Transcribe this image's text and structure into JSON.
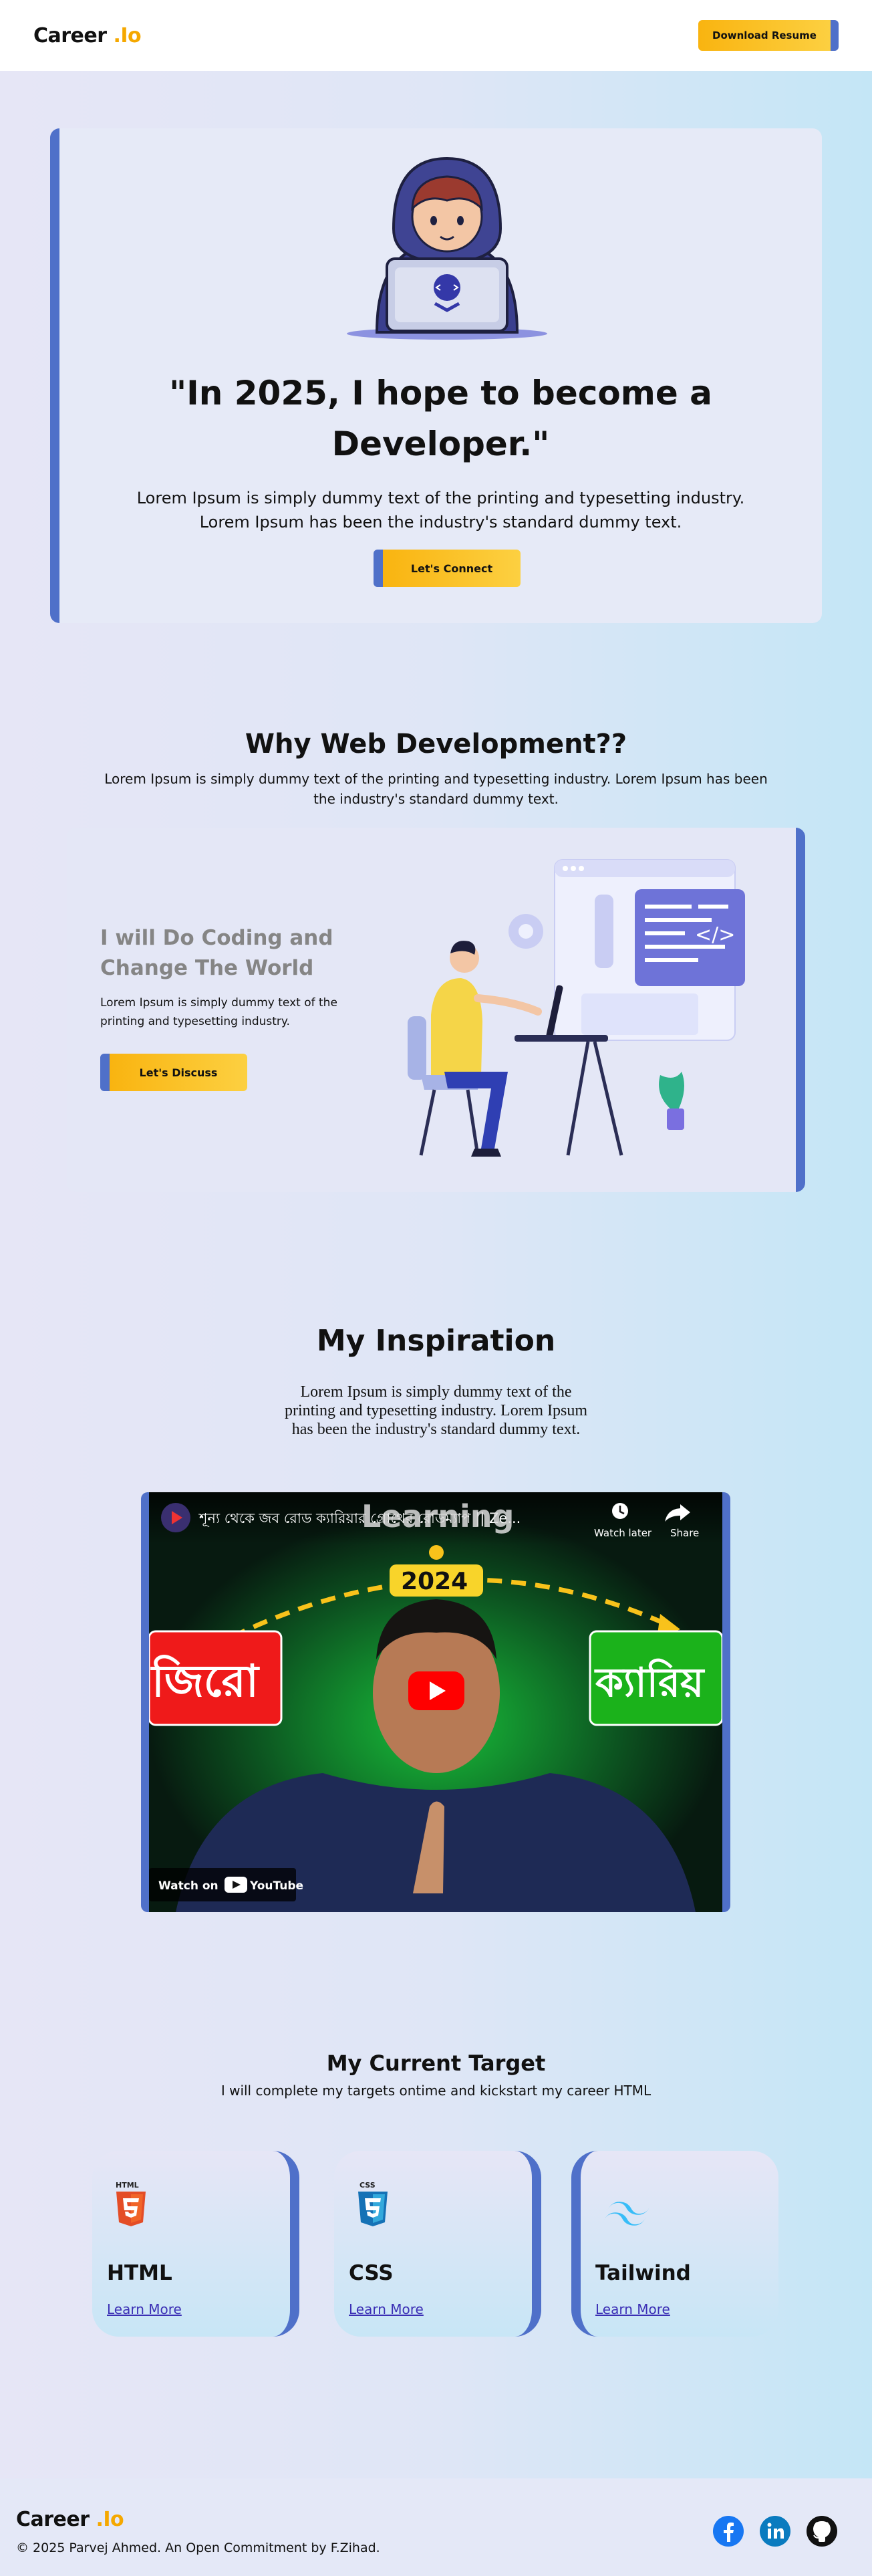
{
  "nav": {
    "logo_main": "Career",
    "logo_accent": ".Io",
    "download_label": "Download Resume"
  },
  "hero": {
    "heading": "\"In 2025, I hope to become a Developer.\"",
    "text": "Lorem Ipsum is simply dummy text of the printing and typesetting industry. Lorem Ipsum has been the industry's standard dummy text.",
    "button_label": "Let's Connect"
  },
  "why": {
    "title": "Why Web Development??",
    "subtitle": "Lorem Ipsum is simply dummy text of the printing and typesetting industry. Lorem Ipsum has been the industry's standard dummy text.",
    "card_heading": "I will Do Coding and Change The World",
    "card_text": "Lorem Ipsum is simply dummy text of the printing and typesetting industry.",
    "button_label": "Let's Discuss"
  },
  "inspiration": {
    "title": "My Inspiration",
    "text": "Lorem Ipsum is simply dummy text of the printing and typesetting industry. Lorem Ipsum has been the industry's standard dummy text.",
    "video": {
      "title": "শূন্য থেকে জব রোড ক্যারিয়ার গ্রোথের রোডম্যাপ || Ze...",
      "overlay_word": "Learning",
      "year": "2024",
      "left_word": "জিরো",
      "right_word": "ক্যারিয়",
      "watch_later": "Watch later",
      "share": "Share",
      "watch_on": "Watch on",
      "youtube": "YouTube"
    }
  },
  "target": {
    "title": "My Current Target",
    "subtitle": "I will complete my targets ontime and kickstart my career HTML",
    "cards": [
      {
        "name": "HTML",
        "link": "Learn More",
        "badge": "HTML"
      },
      {
        "name": "CSS",
        "link": "Learn More",
        "badge": "CSS"
      },
      {
        "name": "Tailwind",
        "link": "Learn More"
      }
    ]
  },
  "footer": {
    "logo_main": "Career",
    "logo_accent": ".Io",
    "copyright": "© 2025 Parvej Ahmed. An Open Commitment by F.Zihad.",
    "social": [
      "facebook-icon",
      "linkedin-icon",
      "github-icon"
    ]
  },
  "colors": {
    "accent_yellow": "#f9b410",
    "accent_blue": "#4f70c9",
    "link_purple": "#3b2fb5"
  }
}
